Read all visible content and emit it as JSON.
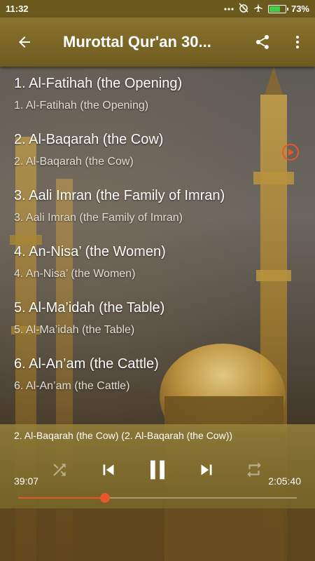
{
  "status_bar": {
    "time": "11:32",
    "battery_percent": "73%",
    "battery_level": 0.73,
    "icons": [
      "dots-icon",
      "alarm-off-icon",
      "airplane-icon",
      "battery-icon"
    ]
  },
  "app_bar": {
    "title": "Murottal Qur'an 30...",
    "icons": [
      "back-arrow-icon",
      "share-icon",
      "more-vert-icon"
    ]
  },
  "tracks": [
    {
      "title": "1. Al-Fatihah (the Opening)",
      "subtitle": "1. Al-Fatihah (the Opening)",
      "playing": false
    },
    {
      "title": "2. Al-Baqarah (the Cow)",
      "subtitle": "2. Al-Baqarah (the Cow)",
      "playing": true
    },
    {
      "title": "3. Aali Imran (the Family of Imran)",
      "subtitle": "3. Aali Imran (the Family of Imran)",
      "playing": false
    },
    {
      "title": "4. An-Nisa’ (the Women)",
      "subtitle": "4. An-Nisa’ (the Women)",
      "playing": false
    },
    {
      "title": "5. Al-Ma’idah (the Table)",
      "subtitle": "5. Al-Ma’idah (the Table)",
      "playing": false
    },
    {
      "title": "6. Al-An’am (the Cattle)",
      "subtitle": "6. Al-An’am (the Cattle)",
      "playing": false
    }
  ],
  "player": {
    "now_playing": "2. Al-Baqarah (the Cow) (2. Al-Baqarah (the Cow))",
    "elapsed": "39:07",
    "duration": "2:05:40",
    "progress": 0.311,
    "controls": [
      "shuffle-icon",
      "previous-icon",
      "pause-icon",
      "next-icon",
      "repeat-icon"
    ]
  },
  "colors": {
    "accent": "#e8572a",
    "app_bar": "#7c6726",
    "status_bar": "#6b5a1e",
    "player_bg": "#8a7430"
  }
}
